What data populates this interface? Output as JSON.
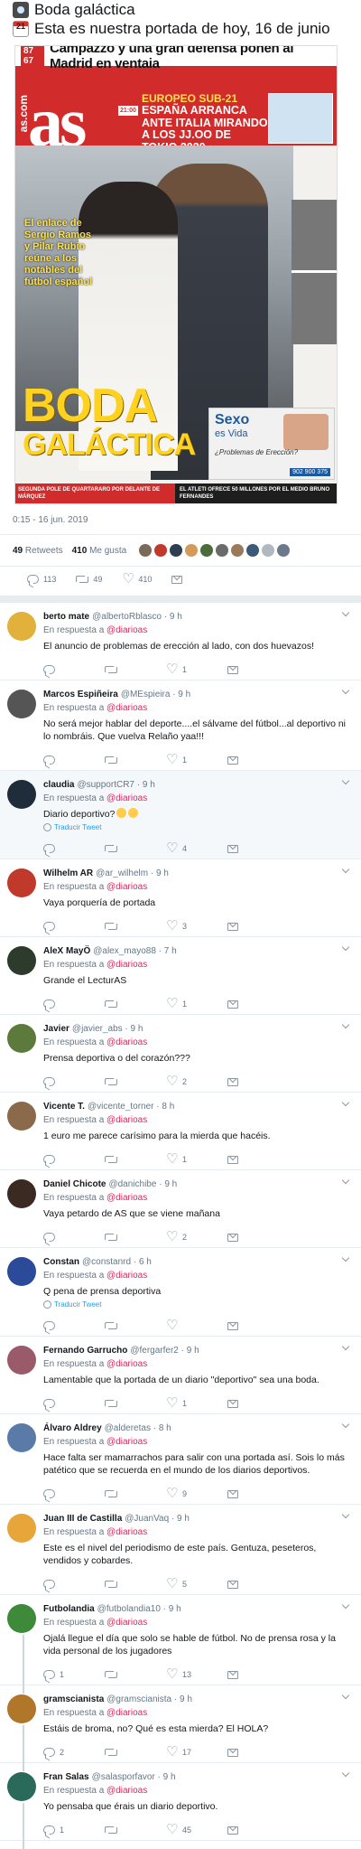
{
  "main_tweet": {
    "line1": "Boda galáctica",
    "line2": "Esta es nuestra portada de hoy, 16 de junio",
    "calendar_day": "21",
    "timestamp": "0:15 - 16 jun. 2019",
    "retweets_count": "49",
    "retweets_label": "Retweets",
    "likes_count": "410",
    "likes_label": "Me gusta",
    "replies": "113",
    "rts": "49",
    "likes": "410",
    "liker_avatar_colors": [
      "#7a6a5a",
      "#c0392b",
      "#2c3e50",
      "#d49a5a",
      "#4a6b3a",
      "#6b6b6b",
      "#9a7a5a",
      "#3a5a7a",
      "#b0b8c0",
      "#6a7a8a"
    ]
  },
  "cover": {
    "score": "87 67",
    "headline_top": "Campazzo y una gran defensa ponen al Madrid en ventaja",
    "logo": "as",
    "logo_side": "as.com",
    "euro_tag": "EUROPEO SUB-21",
    "euro_text": "ESPAÑA ARRANCA ANTE ITALIA MIRANDO A LOS JJ.OO DE TOKIO 2020",
    "euro_time": "21:00",
    "caption": "El enlace de Sergio Ramos y Pilar Rubio reúne a los notables del fútbol español",
    "title1": "BODA",
    "title2": "GALÁCTICA",
    "ad_title": "Sexo",
    "ad_sub": "es Vida",
    "ad_q": "¿Problemas de Erección?",
    "ad_phone": "902 900 375",
    "strip1": "SEGUNDA POLE DE QUARTARARO POR DELANTE DE MÁRQUEZ",
    "strip2": "EL ATLETI OFRECE 50 MILLONES POR EL MEDIO BRUNO FERNANDES"
  },
  "reply_prefix": "En respuesta a",
  "reply_mention": "@diarioas",
  "translate_label": "Traducir Tweet",
  "replies": [
    {
      "name": "berto mate",
      "handle": "@albertoRblasco · 9 h",
      "text": "El anuncio de problemas de erección al lado, con dos huevazos!",
      "reply": "",
      "rt": "",
      "like": "1",
      "avatar": "#e2b13c",
      "threaded": false,
      "translate": false,
      "highlight": false
    },
    {
      "name": "Marcos Espiñeira",
      "handle": "@MEspieira · 9 h",
      "text": "No será mejor hablar del deporte....el sálvame del fútbol...al deportivo ni lo nombráis. Que vuelva Relaño yaa!!!",
      "reply": "",
      "rt": "",
      "like": "1",
      "avatar": "#555555",
      "threaded": false,
      "translate": false,
      "highlight": false
    },
    {
      "name": "claudia",
      "handle": "@supportCR7 · 9 h",
      "text": "Diario deportivo?",
      "reply": "",
      "rt": "",
      "like": "4",
      "avatar": "#1f2c3a",
      "threaded": false,
      "translate": true,
      "highlight": true,
      "emojis": 2
    },
    {
      "name": "Wilhelm AR",
      "handle": "@ar_wilhelm · 9 h",
      "text": "Vaya porquería de portada",
      "reply": "",
      "rt": "",
      "like": "3",
      "avatar": "#c0392b",
      "threaded": false,
      "translate": false,
      "highlight": false
    },
    {
      "name": "AleX MayÖ",
      "handle": "@alex_mayo88 · 7 h",
      "text": "Grande el LecturAS",
      "reply": "",
      "rt": "",
      "like": "1",
      "avatar": "#2d3b2d",
      "threaded": false,
      "translate": false,
      "highlight": false
    },
    {
      "name": "Javier",
      "handle": "@javier_abs · 9 h",
      "text": "Prensa deportiva o del corazón???",
      "reply": "",
      "rt": "",
      "like": "2",
      "avatar": "#5b7a3c",
      "threaded": false,
      "translate": false,
      "highlight": false
    },
    {
      "name": "Vicente T.",
      "handle": "@vicente_torner · 8 h",
      "text": "1 euro me parece carísimo para la mierda que hacéis.",
      "reply": "",
      "rt": "",
      "like": "1",
      "avatar": "#8a6a4a",
      "threaded": false,
      "translate": false,
      "highlight": false
    },
    {
      "name": "Daniel Chicote",
      "handle": "@danichibe · 9 h",
      "text": "Vaya petardo de AS que se viene mañana",
      "reply": "",
      "rt": "",
      "like": "2",
      "avatar": "#3a2a22",
      "threaded": false,
      "translate": false,
      "highlight": false
    },
    {
      "name": "Constan",
      "handle": "@constanrd · 6 h",
      "text": "Q pena de prensa deportiva",
      "reply": "",
      "rt": "",
      "like": "",
      "avatar": "#2b4a9a",
      "threaded": false,
      "translate": true,
      "highlight": false
    },
    {
      "name": "Fernando Garrucho",
      "handle": "@fergarfer2 · 9 h",
      "text": "Lamentable que la portada de un diario \"deportivo\" sea una boda.",
      "reply": "",
      "rt": "",
      "like": "1",
      "avatar": "#9a5a6a",
      "threaded": false,
      "translate": false,
      "highlight": false
    },
    {
      "name": "Álvaro Aldrey",
      "handle": "@alderetas · 8 h",
      "text": "Hace falta ser mamarrachos para salir con una portada así. Sois lo más patético que se recuerda en el mundo de los diarios deportivos.",
      "reply": "",
      "rt": "",
      "like": "9",
      "avatar": "#5a7aa8",
      "threaded": false,
      "translate": false,
      "highlight": false
    },
    {
      "name": "Juan III de Castilla",
      "handle": "@JuanVaq · 9 h",
      "text": "Este es el nivel del periodismo de este país. Gentuza, peseteros, vendidos y cobardes.",
      "reply": "",
      "rt": "",
      "like": "5",
      "avatar": "#e7a53a",
      "threaded": false,
      "translate": false,
      "highlight": false
    },
    {
      "name": "Futbolandia",
      "handle": "@futbolandia10 · 9 h",
      "text": "Ojalá llegue el día que solo se hable de fútbol. No de prensa rosa y la vida personal de los jugadores",
      "reply": "1",
      "rt": "",
      "like": "13",
      "avatar": "#3c8a3a",
      "threaded": true,
      "translate": false,
      "highlight": false
    },
    {
      "name": "gramscianista",
      "handle": "@gramscianista · 9 h",
      "text": "Estáis de broma, no? Qué es esta mierda? El HOLA?",
      "reply": "2",
      "rt": "",
      "like": "17",
      "avatar": "#b0772a",
      "threaded": true,
      "translate": false,
      "highlight": false
    },
    {
      "name": "Fran Salas",
      "handle": "@salasporfavor · 9 h",
      "text": "Yo pensaba que érais un diario deportivo.",
      "reply": "1",
      "rt": "",
      "like": "45",
      "avatar": "#2a6a5a",
      "threaded": true,
      "translate": false,
      "highlight": false
    }
  ]
}
